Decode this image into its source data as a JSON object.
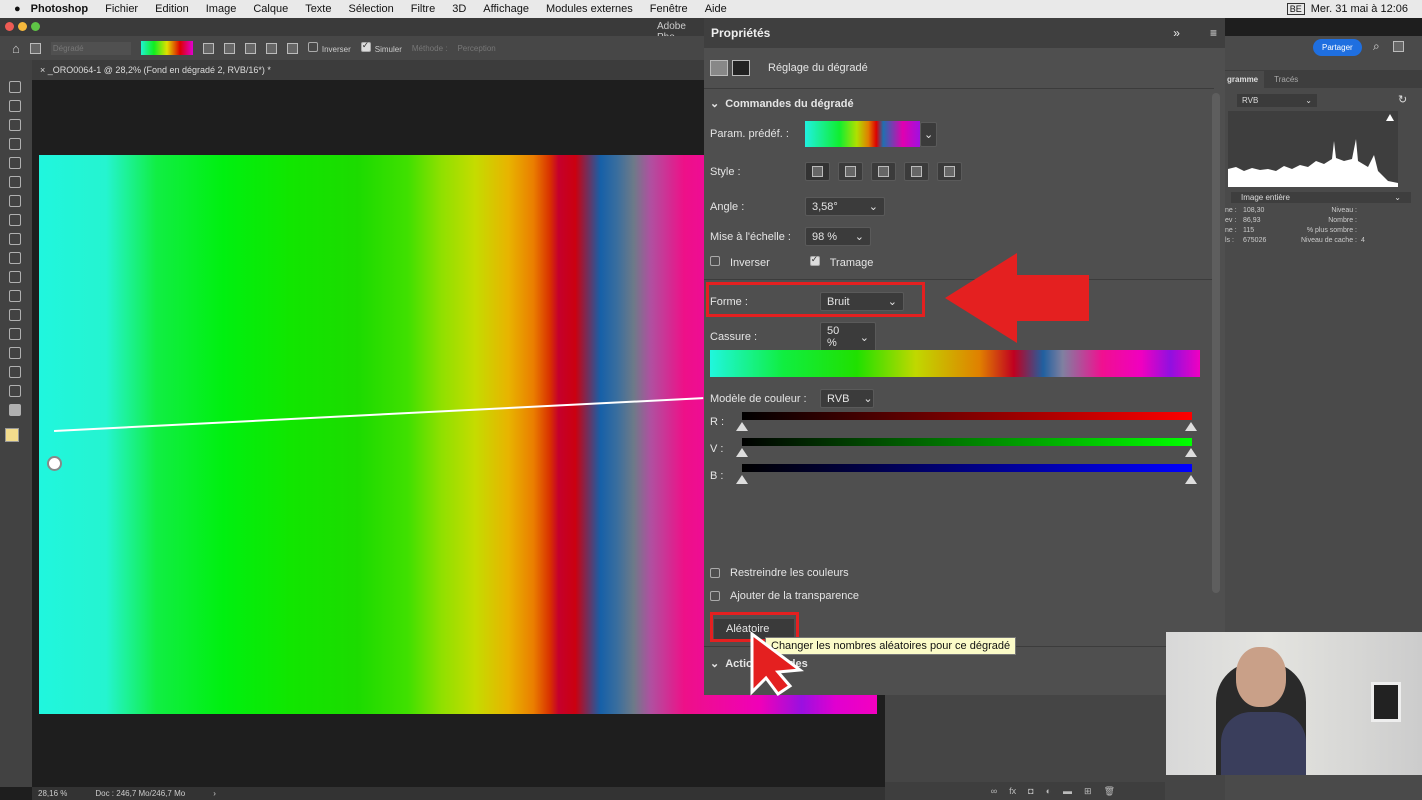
{
  "menubar": {
    "app": "Photoshop",
    "items": [
      "Fichier",
      "Edition",
      "Image",
      "Calque",
      "Texte",
      "Sélection",
      "Filtre",
      "3D",
      "Affichage",
      "Modules externes",
      "Fenêtre",
      "Aide"
    ],
    "clock": "Mer. 31 mai à 12:06",
    "keyboard": "BE"
  },
  "window": {
    "title": "Adobe Pho"
  },
  "options": {
    "preset": "Dégradé",
    "inverser": "Inverser",
    "simuler": "Simuler",
    "methode": "Méthode :",
    "perception": "Perception",
    "share": "Partager"
  },
  "document": {
    "tab": "_ORO0064-1 @ 28,2% (Fond en dégradé 2, RVB/16*) *",
    "zoom": "28,16 %",
    "doc": "Doc : 246,7 Mo/246,7 Mo"
  },
  "props": {
    "title": "Propriétés",
    "subtitle": "Réglage du dégradé",
    "section": "Commandes du dégradé",
    "preset_label": "Param. prédéf. :",
    "style_label": "Style :",
    "angle_label": "Angle :",
    "angle": "3,58°",
    "scale_label": "Mise à l'échelle :",
    "scale": "98 %",
    "inverser": "Inverser",
    "inverser_checked": false,
    "tramage": "Tramage",
    "tramage_checked": true,
    "forme_label": "Forme :",
    "forme": "Bruit",
    "cassure_label": "Cassure :",
    "cassure": "50 %",
    "model_label": "Modèle de couleur :",
    "model": "RVB",
    "channels": [
      "R :",
      "V :",
      "B :"
    ],
    "restrict": "Restreindre les couleurs",
    "transparence": "Ajouter de la transparence",
    "random_button": "Aléatoire",
    "tooltip": "Changer les nombres aléatoires pour ce dégradé",
    "next_section": "Actions rapides"
  },
  "histogram": {
    "tab1": "gramme",
    "tab2": "Tracés",
    "channel": "RVB",
    "source": "Image entière",
    "stats": [
      [
        "ne :",
        "108,30",
        "Niveau :",
        ""
      ],
      [
        "ev :",
        "86,93",
        "Nombre :",
        ""
      ],
      [
        "ne :",
        "115",
        "% plus sombre :",
        ""
      ],
      [
        "ls :",
        "675026",
        "Niveau de cache :",
        "4"
      ]
    ]
  },
  "colors": {
    "accent": "#1f6fe0",
    "highlight": "#e42020"
  }
}
